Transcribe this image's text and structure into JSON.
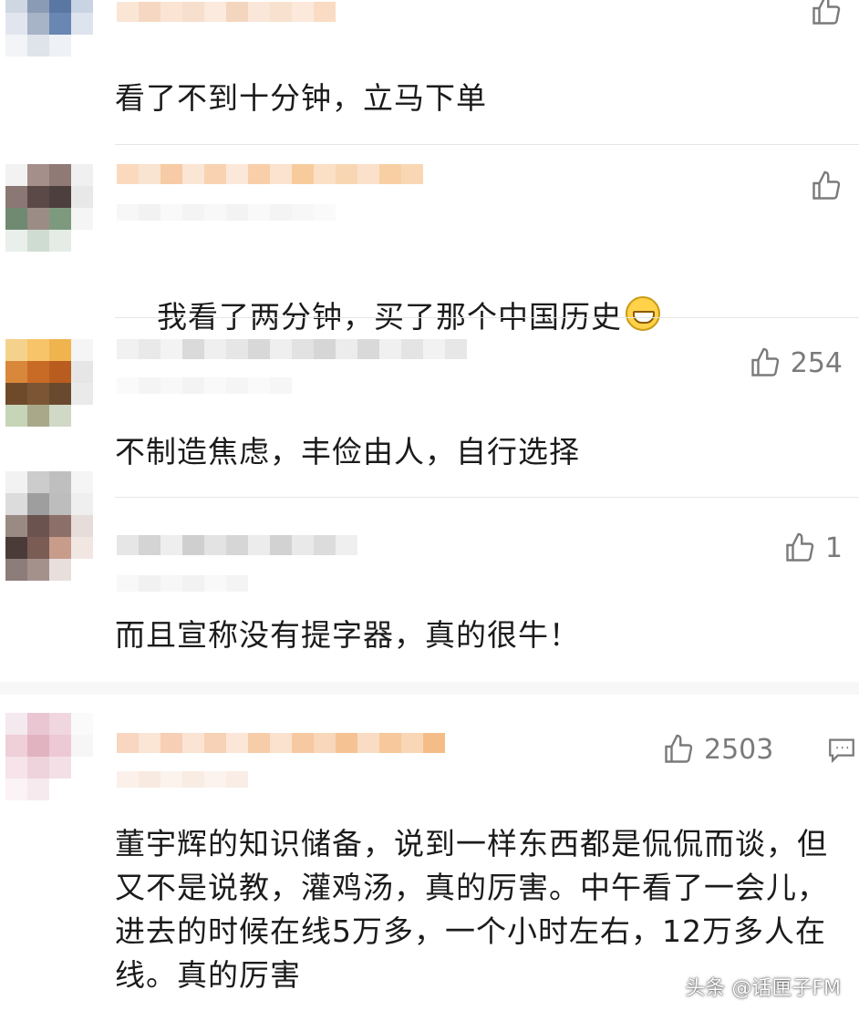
{
  "comments": [
    {
      "text": "看了不到十分钟，立马下单",
      "likes": ""
    },
    {
      "text": "我看了两分钟，买了那个中国历史",
      "likes": "",
      "emoji": "grin-emoji"
    },
    {
      "text": "不制造焦虑，丰俭由人，自行选择",
      "likes": "254"
    },
    {
      "text": "而且宣称没有提字器，真的很牛！",
      "likes": "1"
    },
    {
      "text": "董宇辉的知识储备，说到一样东西都是侃侃而谈，但又不是说教，灌鸡汤，真的厉害。中午看了一会儿，进去的时候在线5万多，一个小时左右，12万多人在线。真的厉害",
      "likes": "2503"
    }
  ],
  "watermark": "头条 @话匣子FM",
  "colors": {
    "text": "#1b1b1b",
    "icon": "#7a7a7a",
    "divider": "#e6e6e6"
  }
}
